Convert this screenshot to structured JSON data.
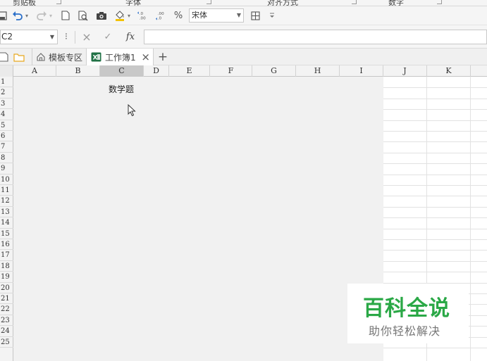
{
  "ribbon": {
    "groups": [
      "剪贴板",
      "字体",
      "对齐方式",
      "数字"
    ]
  },
  "toolbar": {
    "percent": "%",
    "font_name": "宋体"
  },
  "formula_bar": {
    "name_box": "C2",
    "more": "⁝",
    "cancel": "×",
    "confirm": "✓",
    "fx": "fx",
    "value": ""
  },
  "tabs": {
    "template_label": "模板专区",
    "workbook_label": "工作簿1",
    "close": "×",
    "add": "+"
  },
  "sheet": {
    "columns": [
      "A",
      "B",
      "C",
      "D",
      "E",
      "F",
      "G",
      "H",
      "I",
      "J",
      "K"
    ],
    "selected_column": "C",
    "rows": [
      "1",
      "2",
      "3",
      "4",
      "5",
      "6",
      "7",
      "8",
      "9",
      "10",
      "11",
      "12",
      "13",
      "14",
      "15",
      "16",
      "17",
      "18",
      "19",
      "20",
      "21",
      "22",
      "23",
      "24",
      "25"
    ],
    "c1_value": "数学题"
  },
  "watermark": {
    "title": "百科全说",
    "subtitle": "助你轻松解决",
    "color": "#2aa846"
  }
}
